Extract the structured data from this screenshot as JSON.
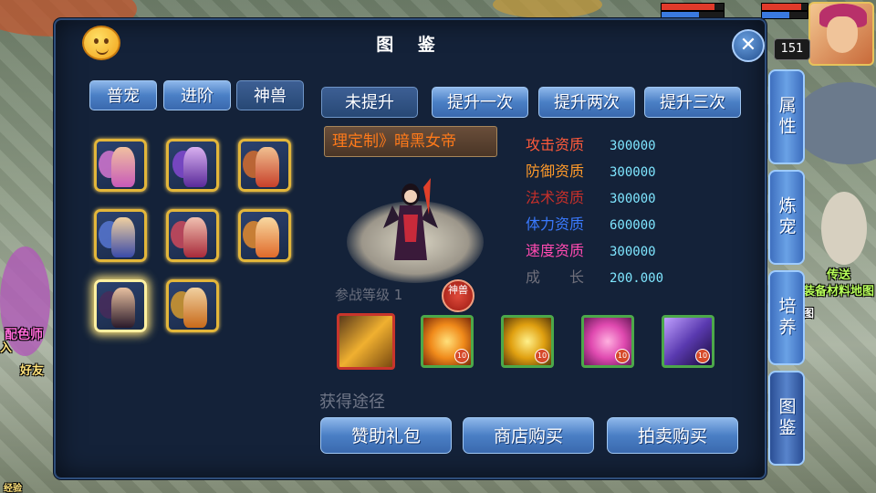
{
  "hud": {
    "player_level": "151",
    "map_marker_teleport": "传送",
    "map_marker_materials": "装备材料地图",
    "map_marker_tu": "图",
    "npc_label_1": "配色师",
    "npc_label_2": "好友",
    "npc_label_3": "入",
    "npc_label_4": "经验",
    "hp_fraction": 0.85,
    "mp_fraction": 0.6
  },
  "side_tabs": [
    "属性",
    "炼宠",
    "培养",
    "图鉴"
  ],
  "panel": {
    "title": "图 鉴",
    "close_symbol": "✕",
    "category_tabs": [
      "普宠",
      "进阶",
      "神兽"
    ],
    "selected_category": "神兽",
    "upgrade_tabs": [
      "未提升",
      "提升一次",
      "提升两次",
      "提升三次"
    ],
    "selected_upgrade": "未提升",
    "pet_name": "理定制》暗黑女帝",
    "stats": [
      {
        "label": "攻击资质",
        "value": "300000",
        "color": "#ff5a3a"
      },
      {
        "label": "防御资质",
        "value": "300000",
        "color": "#ff9a2a"
      },
      {
        "label": "法术资质",
        "value": "300000",
        "color": "#c8302a"
      },
      {
        "label": "体力资质",
        "value": "600000",
        "color": "#3a7aff"
      },
      {
        "label": "速度资质",
        "value": "300000",
        "color": "#ff4ab0"
      },
      {
        "label": "成　　长",
        "value": "200.000",
        "color": "#6f6f7a"
      }
    ],
    "battle_level": "参战等级 1",
    "beast_badge": "神兽",
    "skills": [
      {
        "name": "golden-arrows",
        "level": ""
      },
      {
        "name": "fire-strike",
        "level": "10"
      },
      {
        "name": "gold-shield",
        "level": "10"
      },
      {
        "name": "pink-heart",
        "level": "10"
      },
      {
        "name": "shadow-dash",
        "level": "10"
      }
    ],
    "acquire_label": "获得途径",
    "acquire_buttons": [
      "赞助礼包",
      "商店购买",
      "拍卖购买"
    ]
  }
}
